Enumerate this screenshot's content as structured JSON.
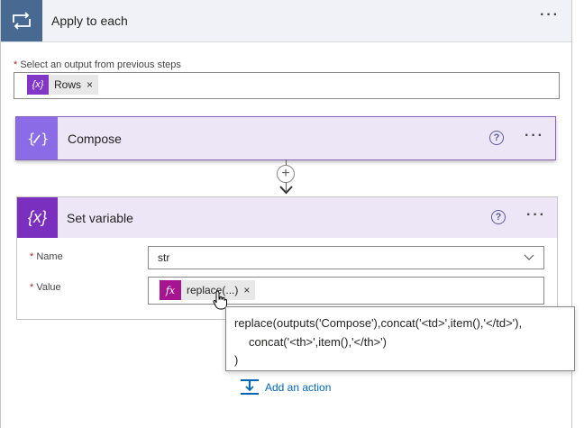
{
  "apply_to_each": {
    "title": "Apply to each",
    "more": "···",
    "output_label": "Select an output from previous steps",
    "required_mark": "*",
    "token": {
      "icon": "{x}",
      "label": "Rows",
      "remove": "×"
    }
  },
  "compose": {
    "title": "Compose",
    "icon": "{✐}",
    "help": "?",
    "more": "···"
  },
  "set_variable": {
    "title": "Set variable",
    "icon": "{x}",
    "help": "?",
    "more": "···",
    "name_label": "Name",
    "name_value": "str",
    "value_label": "Value",
    "value_token": {
      "icon": "fx",
      "label": "replace(...)",
      "remove": "×"
    }
  },
  "tooltip": {
    "line1": "replace(outputs('Compose'),concat('<td>',item(),'</td>'),",
    "line2": "concat('<th>',item(),'</th>')",
    "line3": ")"
  },
  "add_action": {
    "label": "Add an action"
  },
  "colors": {
    "apply_each_accent": "#486991",
    "compose_accent": "#8b6ce6",
    "variable_accent": "#7b2fbe",
    "expression_accent": "#a4158f",
    "link": "#0067b8"
  }
}
